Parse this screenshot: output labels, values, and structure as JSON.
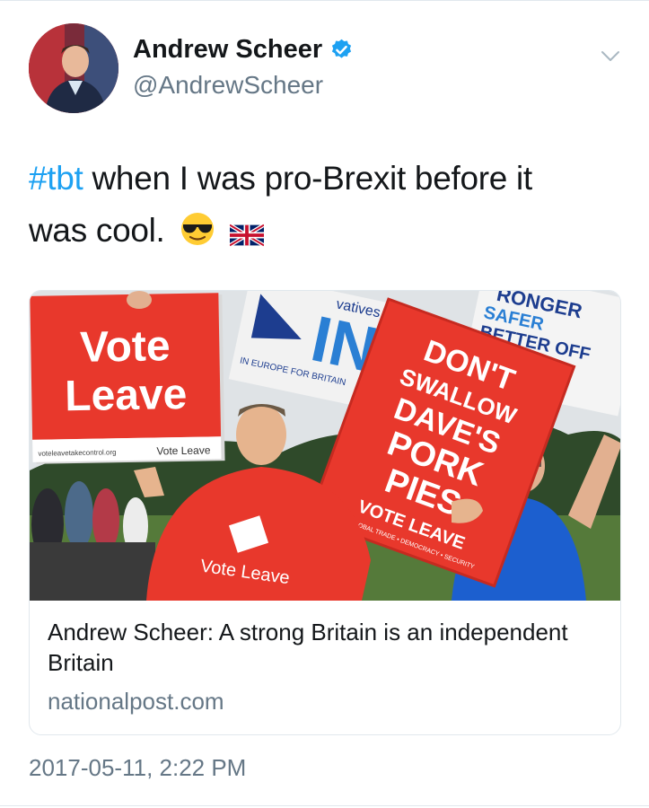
{
  "user": {
    "display_name": "Andrew Scheer",
    "handle": "@AndrewScheer",
    "verified": true
  },
  "tweet": {
    "hashtag": "#tbt",
    "text_line1": " when I was pro-Brexit before it",
    "text_line2": "was cool.",
    "emojis": [
      "sunglasses-emoji",
      "uk-flag-emoji"
    ]
  },
  "card": {
    "title": "Andrew Scheer: A strong Britain is an independent Britain",
    "domain": "nationalpost.com",
    "image_signs": {
      "sign_left_line1": "Vote",
      "sign_left_line2": "Leave",
      "sign_left_url": "voteleavetakecontrol.org",
      "sign_left_footer": "Vote Leave",
      "sign_in_text": "IN",
      "sign_in_top": "vatives",
      "sign_in_bottom": "IN EUROPE FOR BRITAIN",
      "sign_right_line1": "RONGER",
      "sign_right_line2": "SAFER",
      "sign_right_line3": "BETTER OFF",
      "sign_center_line1": "DON'T",
      "sign_center_line2": "SWALLOW",
      "sign_center_line3": "DAVE'S",
      "sign_center_line4": "PORK",
      "sign_center_line5": "PIES",
      "sign_center_footer": "VOTE LEAVE",
      "sign_center_tagline": "FOR GLOBAL TRADE • DEMOCRACY • SECURITY",
      "shirt_text": "Vote Leave"
    }
  },
  "timestamp": "2017-05-11, 2:22 PM",
  "colors": {
    "accent": "#1da1f2",
    "secondary_text": "#657786",
    "vote_leave_red": "#e8382c"
  }
}
